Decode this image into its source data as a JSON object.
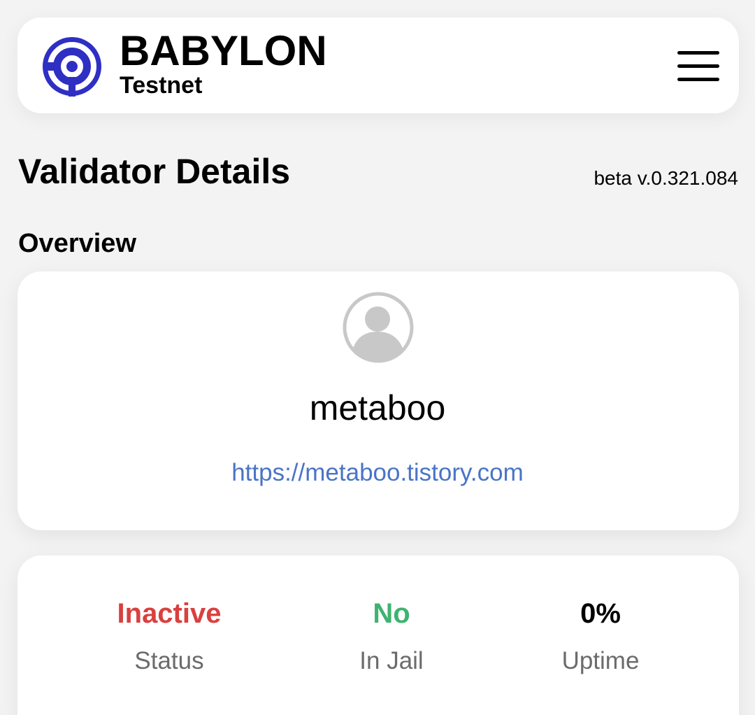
{
  "header": {
    "brand_name": "BABYLON",
    "network": "Testnet",
    "logo_icon": "babylon-logo-icon",
    "menu_icon": "hamburger-menu-icon"
  },
  "page": {
    "title": "Validator Details",
    "version": "beta v.0.321.084",
    "section": "Overview"
  },
  "validator": {
    "avatar_icon": "user-avatar-icon",
    "moniker": "metaboo",
    "website": "https://metaboo.tistory.com"
  },
  "stats": {
    "status": {
      "value": "Inactive",
      "label": "Status",
      "color": "#d9403f"
    },
    "in_jail": {
      "value": "No",
      "label": "In Jail",
      "color": "#3eb370"
    },
    "uptime": {
      "value": "0%",
      "label": "Uptime",
      "color": "#000000"
    }
  },
  "colors": {
    "brand_blue": "#2f2fc4",
    "link": "#4a74c6",
    "background": "#f3f3f3",
    "card": "#ffffff"
  }
}
